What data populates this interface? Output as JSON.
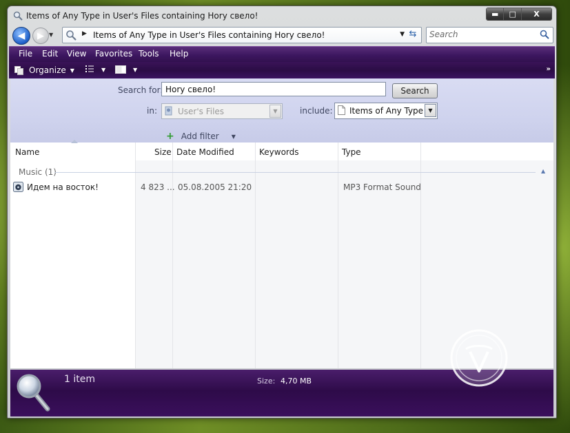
{
  "window": {
    "title": "Items of Any Type in User's Files containing Hory свело!",
    "caption_buttons": {
      "minimize": "▬",
      "maximize": "□",
      "close": "X"
    }
  },
  "address": {
    "path": "Items of Any Type in User's Files containing Hory свело!",
    "search_placeholder": "Search"
  },
  "menu": [
    "File",
    "Edit",
    "View",
    "Favorites",
    "Tools",
    "Help"
  ],
  "toolbar": {
    "organize": "Organize"
  },
  "search_pane": {
    "search_for_label": "Search for:",
    "search_for_value": "Hory свело!",
    "search_button": "Search",
    "in_label": "in:",
    "in_value": "User's Files",
    "include_label": "include:",
    "include_value": "Items of Any Type",
    "add_filter": "Add filter"
  },
  "columns": [
    "Name",
    "Size",
    "Date Modified",
    "Keywords",
    "Type"
  ],
  "group": {
    "label": "Music (1)"
  },
  "files": [
    {
      "name": "Идем на восток!",
      "size": "4 823 ...",
      "date_modified": "05.08.2005 21:20",
      "keywords": "",
      "type": "MP3 Format Sound",
      "icon": "audio-file-icon"
    }
  ],
  "details": {
    "item_count": "1 item",
    "size_label": "Size:",
    "size_value": "4,70 MB"
  },
  "colors": {
    "accent_purple": "#3d1760",
    "search_pane_bg": "#d2d6ef",
    "window_chrome": "#d4d6d8"
  }
}
